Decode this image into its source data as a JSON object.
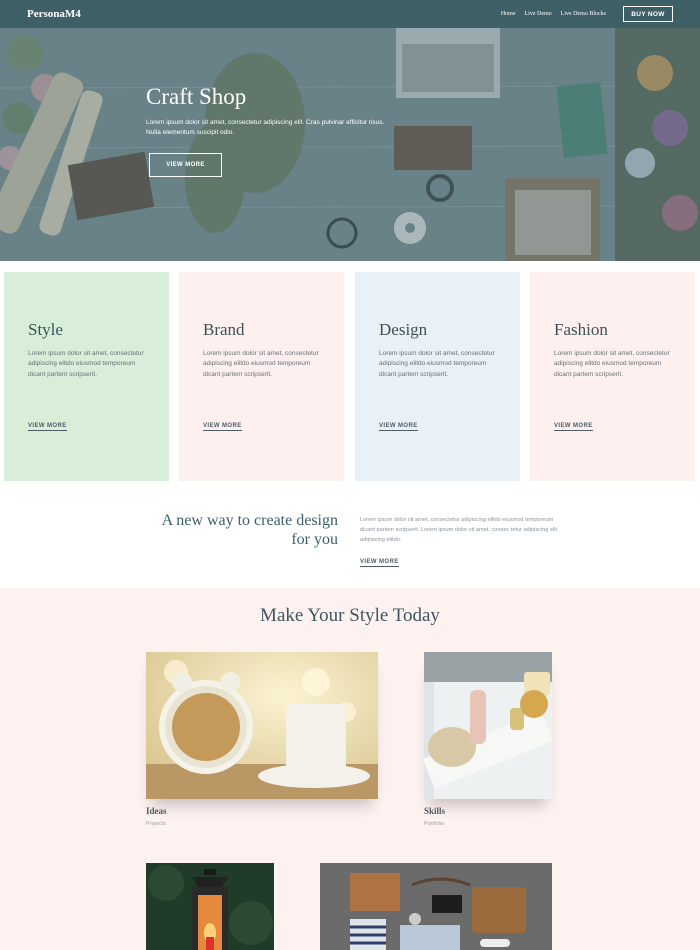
{
  "nav": {
    "brand": "PersonaM4",
    "links": [
      "Home",
      "Live Demo",
      "Live Demo Blocks"
    ],
    "buy_label": "BUY NOW"
  },
  "hero": {
    "title": "Craft Shop",
    "text": "Lorem ipsum dolor sit amet, consectetur adipiscing elit. Cras pulvinar efficitur risus. Nulla elementum suscipit odio.",
    "button": "VIEW MORE"
  },
  "cards": [
    {
      "title": "Style",
      "text": "Lorem ipsum dolor sit amet, consectetur adipiscing elitdo eiusmod temporeum dicant partem scripserit.",
      "link": "VIEW MORE",
      "bg": "#d8eed8"
    },
    {
      "title": "Brand",
      "text": "Lorem ipsum dolor sit amet, consectetur adipiscing elitdo eiusmod temporeum dicant partem scripserit.",
      "link": "VIEW MORE",
      "bg": "#fdf0ee"
    },
    {
      "title": "Design",
      "text": "Lorem ipsum dolor sit amet, consectetur adipiscing elitdo eiusmod temporeum dicant partem scripserit.",
      "link": "VIEW MORE",
      "bg": "#e8f1f8"
    },
    {
      "title": "Fashion",
      "text": "Lorem ipsum dolor sit amet, consectetur adipiscing elitdo eiusmod temporeum dicant partem scripserit.",
      "link": "VIEW MORE",
      "bg": "#fdf0ee"
    }
  ],
  "newway": {
    "title": "A new way to create design for you",
    "text": "Lorem ipsum dolor sit amet, consectetur adipiscing elitdo eiusmod temporeum dicant partem scripserit. Lorem ipsum dolor sit amet, consec tetur adipiscing elit adipiscing elitdo.",
    "link": "VIEW MORE"
  },
  "portfolio": {
    "title": "Make Your Style Today",
    "items": [
      {
        "name": "Ideas",
        "category": "Projects"
      },
      {
        "name": "Skills",
        "category": "Portfolio"
      }
    ]
  },
  "colors": {
    "nav": "#3f5f66",
    "section_bg": "#fef2f1",
    "heading": "#3d5760"
  }
}
